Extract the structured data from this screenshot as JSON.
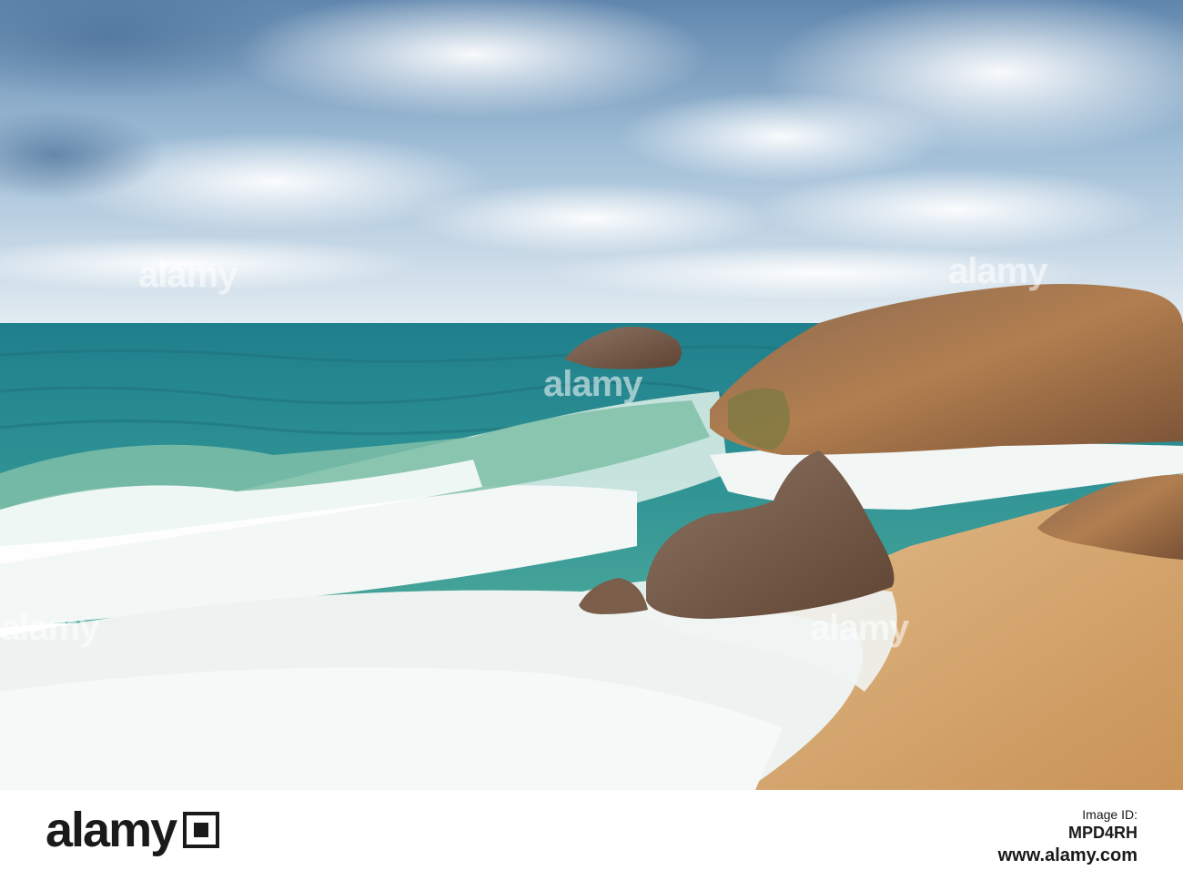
{
  "watermark": {
    "text": "alamy"
  },
  "footer": {
    "logo_text": "alamy",
    "image_id_label": "Image ID:",
    "image_id": "MPD4RH",
    "url": "www.alamy.com"
  },
  "colors": {
    "sky_top": "#6d93b8",
    "sky_horizon": "#dbe6ef",
    "sea_far": "#2f8c93",
    "sea_near": "#3e9c8f",
    "foam": "#f2f5f4",
    "sand": "#d9ad76",
    "rock": "#a4774b",
    "rock_shadow": "#5e4230"
  }
}
